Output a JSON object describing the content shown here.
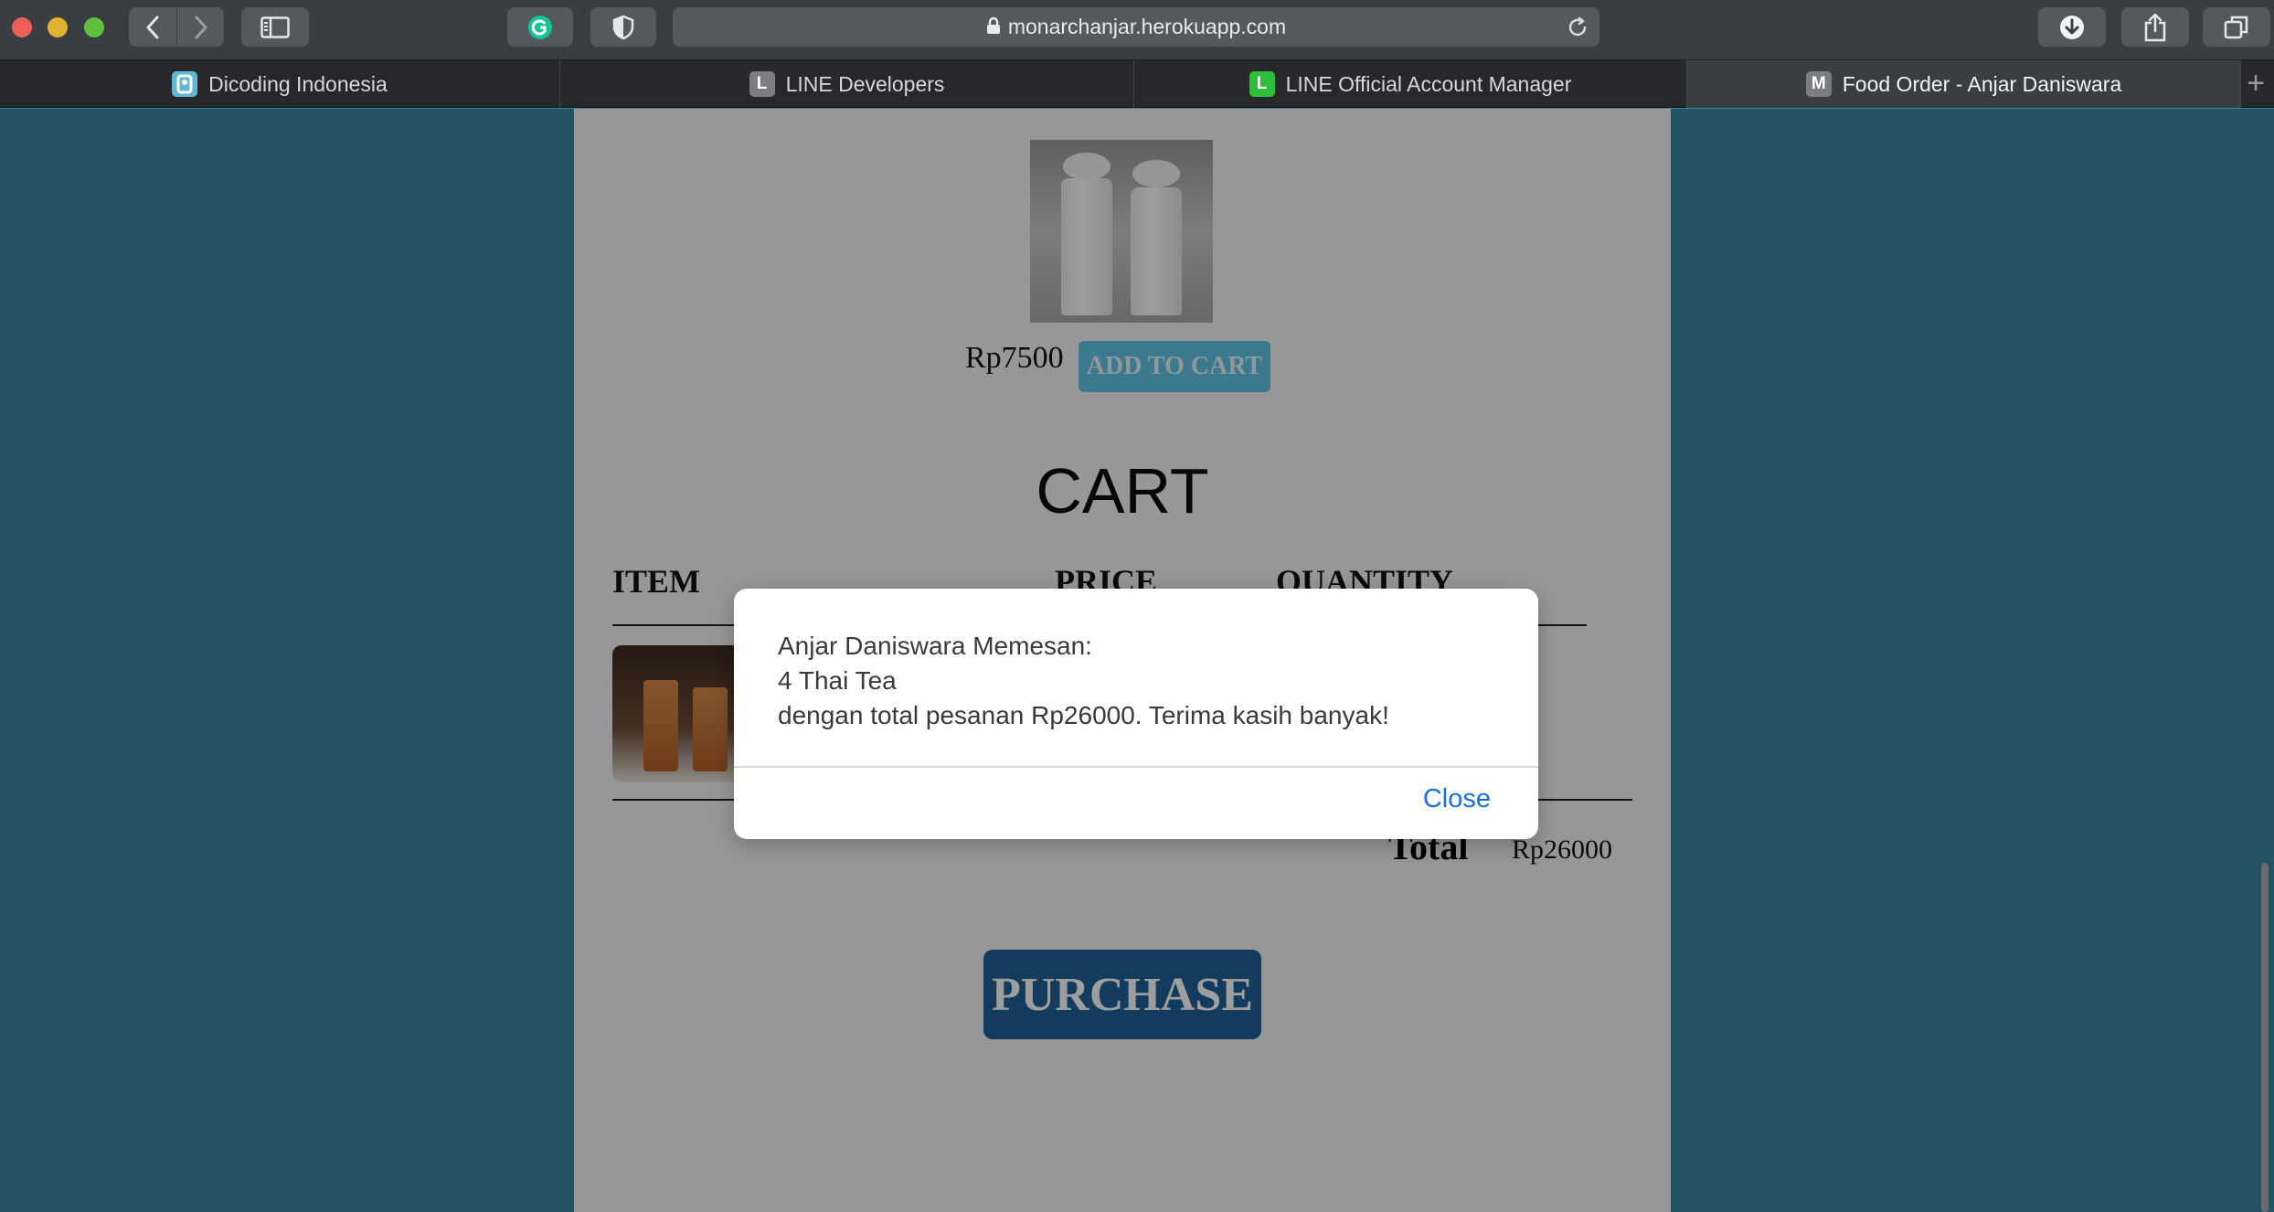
{
  "browser": {
    "url": "monarchanjar.herokuapp.com",
    "tabs": [
      {
        "label": "Dicoding Indonesia",
        "favicon": "dicoding-icon",
        "favicon_color": "#5fb9d4",
        "favicon_letter": "",
        "active": false
      },
      {
        "label": "LINE Developers",
        "favicon": "letter-l-icon",
        "favicon_color": "#7b7d82",
        "favicon_letter": "L",
        "active": false
      },
      {
        "label": "LINE Official Account Manager",
        "favicon": "line-icon",
        "favicon_color": "#2dbf3a",
        "favicon_letter": "L",
        "active": false
      },
      {
        "label": "Food Order - Anjar Daniswara",
        "favicon": "letter-m-icon",
        "favicon_color": "#7b7d82",
        "favicon_letter": "M",
        "active": true
      }
    ],
    "new_tab": "+"
  },
  "product": {
    "price": "Rp7500",
    "add_to_cart_label": "ADD TO CART"
  },
  "cart": {
    "title": "CART",
    "columns": [
      "ITEM",
      "PRICE",
      "QUANTITY"
    ],
    "total_label": "Total",
    "total_value": "Rp26000",
    "purchase_label": "PURCHASE"
  },
  "dialog": {
    "lines": [
      "Anjar Daniswara Memesan:",
      "4 Thai Tea",
      "dengan total pesanan Rp26000. Terima kasih banyak!"
    ],
    "close_label": "Close"
  },
  "colors": {
    "page_background": "#3b86a0",
    "add_to_cart_button": "#5fc4e6",
    "purchase_button": "#1e5f96",
    "dialog_link": "#1a6fd8"
  }
}
